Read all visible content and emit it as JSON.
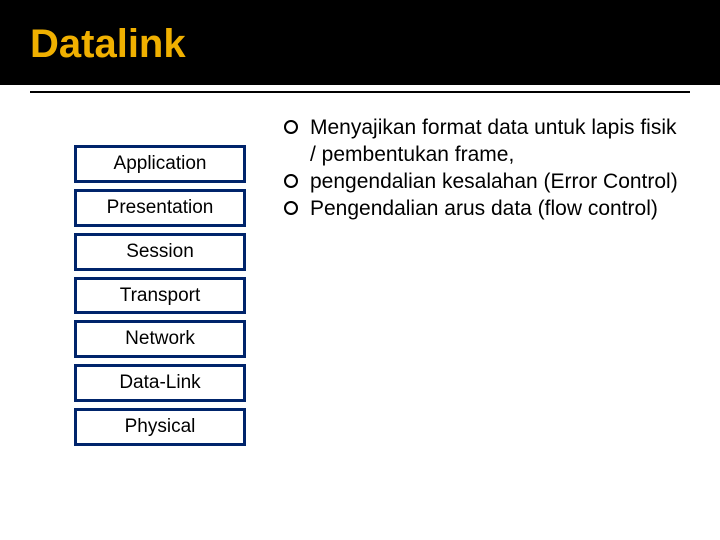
{
  "title": "Datalink",
  "layers": [
    "Application",
    "Presentation",
    "Session",
    "Transport",
    "Network",
    "Data-Link",
    "Physical"
  ],
  "bullets": [
    "Menyajikan format data untuk lapis fisik / pembentukan frame,",
    "pengendalian kesalahan (Error Control)",
    "Pengendalian arus data (flow control)"
  ]
}
